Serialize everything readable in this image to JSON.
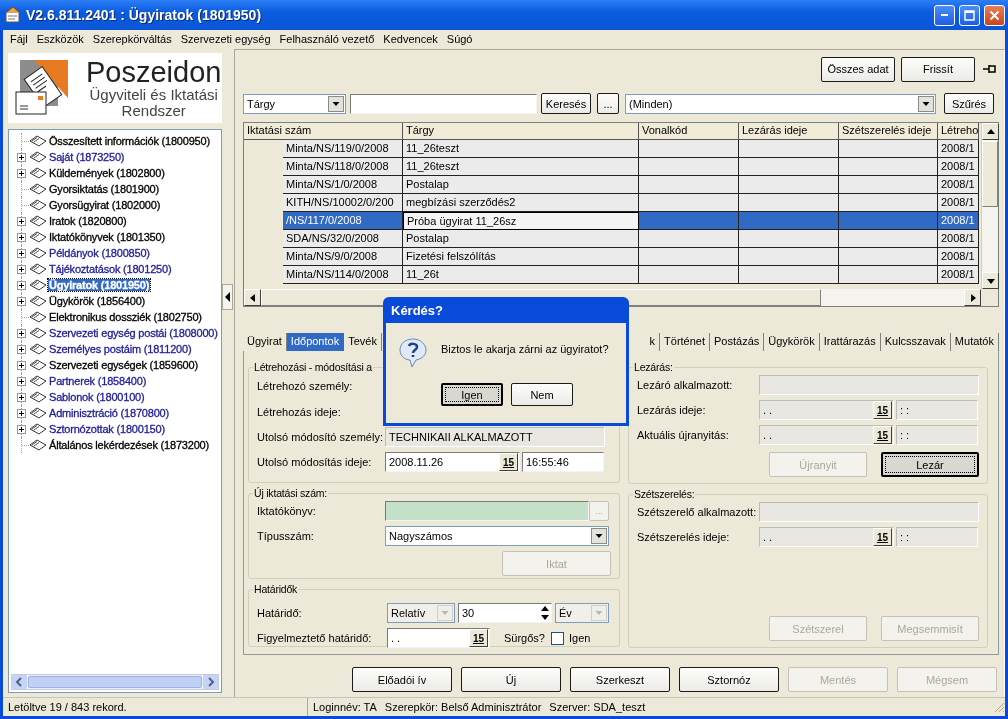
{
  "window": {
    "title": "V2.6.811.2401 : Ügyiratok (1801950)"
  },
  "menu": [
    "Fájl",
    "Eszközök",
    "Szerepkörváltás",
    "Szervezeti egység",
    "Felhasználó vezető",
    "Kedvencek",
    "Súgó"
  ],
  "logo": {
    "name": "Poszeidon",
    "subtitle_1": "Ügyviteli és Iktatási",
    "subtitle_2": "Rendszer"
  },
  "tree": [
    {
      "label": "Összesített információk (1800950)",
      "kind": "leaf",
      "color": "#000000",
      "selected": false
    },
    {
      "label": "Saját (1873250)",
      "kind": "branch",
      "color": "#21219c",
      "selected": false
    },
    {
      "label": "Küldemények (1802800)",
      "kind": "branch",
      "color": "#000000",
      "selected": false
    },
    {
      "label": "Gyorsiktatás (1801900)",
      "kind": "leaf",
      "color": "#000000",
      "selected": false
    },
    {
      "label": "Gyorsügyirat (1802000)",
      "kind": "leaf",
      "color": "#000000",
      "selected": false
    },
    {
      "label": "Iratok (1820800)",
      "kind": "branch",
      "color": "#000000",
      "selected": false
    },
    {
      "label": "Iktatókönyvek (1801350)",
      "kind": "branch",
      "color": "#000000",
      "selected": false
    },
    {
      "label": "Példányok (1800850)",
      "kind": "branch",
      "color": "#21219c",
      "selected": false
    },
    {
      "label": "Tájékoztatások (1801250)",
      "kind": "branch",
      "color": "#21219c",
      "selected": false
    },
    {
      "label": "Ügyiratok (1801950)",
      "kind": "branch",
      "selected": true
    },
    {
      "label": "Ügykörök (1856400)",
      "kind": "branch",
      "color": "#000000",
      "selected": false
    },
    {
      "label": "Elektronikus dossziék (1802750)",
      "kind": "leaf",
      "color": "#000000",
      "selected": false
    },
    {
      "label": "Szervezeti egység postái (1808000)",
      "kind": "branch",
      "color": "#21219c",
      "selected": false
    },
    {
      "label": "Személyes postáim (1811200)",
      "kind": "branch",
      "color": "#21219c",
      "selected": false
    },
    {
      "label": "Szervezeti egységek (1859600)",
      "kind": "branch",
      "color": "#000000",
      "selected": false
    },
    {
      "label": "Partnerek (1858400)",
      "kind": "branch",
      "color": "#21219c",
      "selected": false
    },
    {
      "label": "Sablonok (1800100)",
      "kind": "branch",
      "color": "#21219c",
      "selected": false
    },
    {
      "label": "Adminisztráció (1870800)",
      "kind": "branch",
      "color": "#21219c",
      "selected": false
    },
    {
      "label": "Sztornózottak (1800150)",
      "kind": "branch",
      "color": "#21219c",
      "selected": false
    },
    {
      "label": "Általános lekérdezések (1873200)",
      "kind": "leaf",
      "color": "#000000",
      "selected": false
    }
  ],
  "toolbar": {
    "buttons": [
      "Összes adat",
      "Frissít"
    ]
  },
  "search": {
    "field_select": "Tárgy",
    "search_button": "Keresés",
    "more_button": "...",
    "filter_select": "(Minden)",
    "filter_button": "Szűrés"
  },
  "table": {
    "columns": [
      "Iktatási szám",
      "Tárgy",
      "Vonalkód",
      "Lezárás ideje",
      "Szétszerelés ideje",
      "Létreho"
    ],
    "rows": [
      {
        "iktatasi_szam": "Minta/NS/119/0/2008",
        "targy": "11_26teszt",
        "column_6": "2008/1",
        "selected": false
      },
      {
        "iktatasi_szam": "Minta/NS/118/0/2008",
        "targy": "11_26teszt",
        "column_6": "2008/1",
        "selected": false
      },
      {
        "iktatasi_szam": "Minta/NS/1/0/2008",
        "targy": "Postalap",
        "column_6": "2008/1",
        "selected": false
      },
      {
        "iktatasi_szam": "KITH/NS/10002/0/200",
        "targy": "megbízási szerződés2",
        "column_6": "2008/1",
        "selected": false
      },
      {
        "iktatasi_szam": "/NS/117/0/2008",
        "targy": "Próba ügyirat 11_26sz",
        "column_6": "2008/1",
        "selected": true
      },
      {
        "iktatasi_szam": "SDA/NS/32/0/2008",
        "targy": "Postalap",
        "column_6": "2008/1",
        "selected": false
      },
      {
        "iktatasi_szam": "Minta/NS/9/0/2008",
        "targy": "Fizetési felszólítás",
        "column_6": "2008/1",
        "selected": false
      },
      {
        "iktatasi_szam": "Minta/NS/114/0/2008",
        "targy": "11_26t",
        "column_6": "2008/1",
        "selected": false
      }
    ]
  },
  "tabs": [
    {
      "label": "Ügyirat",
      "selected": false
    },
    {
      "label": "Időpontok",
      "selected": true
    },
    {
      "label": "Tevék",
      "selected": false
    },
    {
      "label": "k",
      "selected": false
    },
    {
      "label": "Történet",
      "selected": false
    },
    {
      "label": "Postázás",
      "selected": false
    },
    {
      "label": "Ügykörök",
      "selected": false
    },
    {
      "label": "Irattárazás",
      "selected": false
    },
    {
      "label": "Kulcsszavak",
      "selected": false
    },
    {
      "label": "Mutatók",
      "selected": false
    }
  ],
  "left_groups": [
    {
      "legend": "Létrehozási - módosítási a",
      "fields": [
        {
          "kind": "label",
          "label": "Létrehozó személy:"
        },
        {
          "kind": "label",
          "label": "Létrehozás ideje:"
        },
        {
          "kind": "text",
          "label": "Utolsó módosító személy:",
          "value": "TECHNIKAII ALKALMAZOTT",
          "disabled": true
        },
        {
          "kind": "datetime",
          "label": "Utolsó módosítás ideje:",
          "date": "2008.11.26",
          "calendar_button": "15",
          "time": "16:55:46",
          "disabled": false
        }
      ]
    },
    {
      "legend": "Új iktatási szám:",
      "fields": [
        {
          "kind": "picker",
          "label": "Iktatókönyv:",
          "button": "...",
          "disabled": true
        },
        {
          "kind": "combo",
          "label": "Típusszám:",
          "value": "Nagyszámos",
          "disabled": false
        }
      ],
      "buttons": [
        {
          "label": "Iktat",
          "disabled": true,
          "focused": false
        }
      ]
    },
    {
      "legend": "Határidők",
      "fields": [
        {
          "kind": "deadline",
          "label": "Határidő:",
          "mode": "Relatív",
          "amount": "30",
          "unit": "Év"
        },
        {
          "kind": "warning",
          "label": "Figyelmeztető határidő:",
          "date": ". .",
          "calendar_button": "15",
          "urgent_label": "Sürgős?",
          "urgent": false,
          "checkbox_label": "Igen"
        }
      ]
    }
  ],
  "right_groups": [
    {
      "legend": "Lezárás:",
      "fields": [
        {
          "kind": "text",
          "label": "Lezáró alkalmazott:",
          "disabled": true
        },
        {
          "kind": "datetime",
          "label": "Lezárás ideje:",
          "date": ". .",
          "calendar_button": "15",
          "time": ": :",
          "disabled": true
        },
        {
          "kind": "datetime",
          "label": "Aktuális újranyitás:",
          "date": ". .",
          "calendar_button": "15",
          "time": ": :",
          "disabled": true
        }
      ],
      "buttons": [
        {
          "label": "Újranyit",
          "disabled": true,
          "focused": false
        },
        {
          "label": "Lezár",
          "disabled": false,
          "focused": true
        }
      ]
    },
    {
      "legend": "Szétszerelés:",
      "fields": [
        {
          "kind": "text",
          "label": "Szétszerelő alkalmazott:",
          "disabled": true
        },
        {
          "kind": "datetime",
          "label": "Szétszerelés ideje:",
          "date": ". .",
          "calendar_button": "15",
          "time": ": :",
          "disabled": true
        }
      ],
      "buttons": [
        {
          "label": "Szétszerel",
          "disabled": true,
          "focused": false
        },
        {
          "label": "Megsemmisít",
          "disabled": true,
          "focused": false
        }
      ]
    }
  ],
  "actions": [
    {
      "label": "Előadói ív",
      "disabled": false
    },
    {
      "label": "Új",
      "disabled": false
    },
    {
      "label": "Szerkeszt",
      "disabled": false
    },
    {
      "label": "Sztornóz",
      "disabled": false
    },
    {
      "label": "Mentés",
      "disabled": true
    },
    {
      "label": "Mégsem",
      "disabled": true
    }
  ],
  "status_bar": {
    "records": "Letöltve 19 / 843 rekord.",
    "login": "Loginnév: TA",
    "role": "Szerepkör: Belső Adminisztrátor",
    "server": "Szerver: SDA_teszt"
  },
  "dialog": {
    "title": "Kérdés?",
    "message": "Biztos le akarja zárni az ügyiratot?",
    "buttons": [
      {
        "label": "Igen",
        "focused": true
      },
      {
        "label": "Nem",
        "focused": false
      }
    ]
  }
}
